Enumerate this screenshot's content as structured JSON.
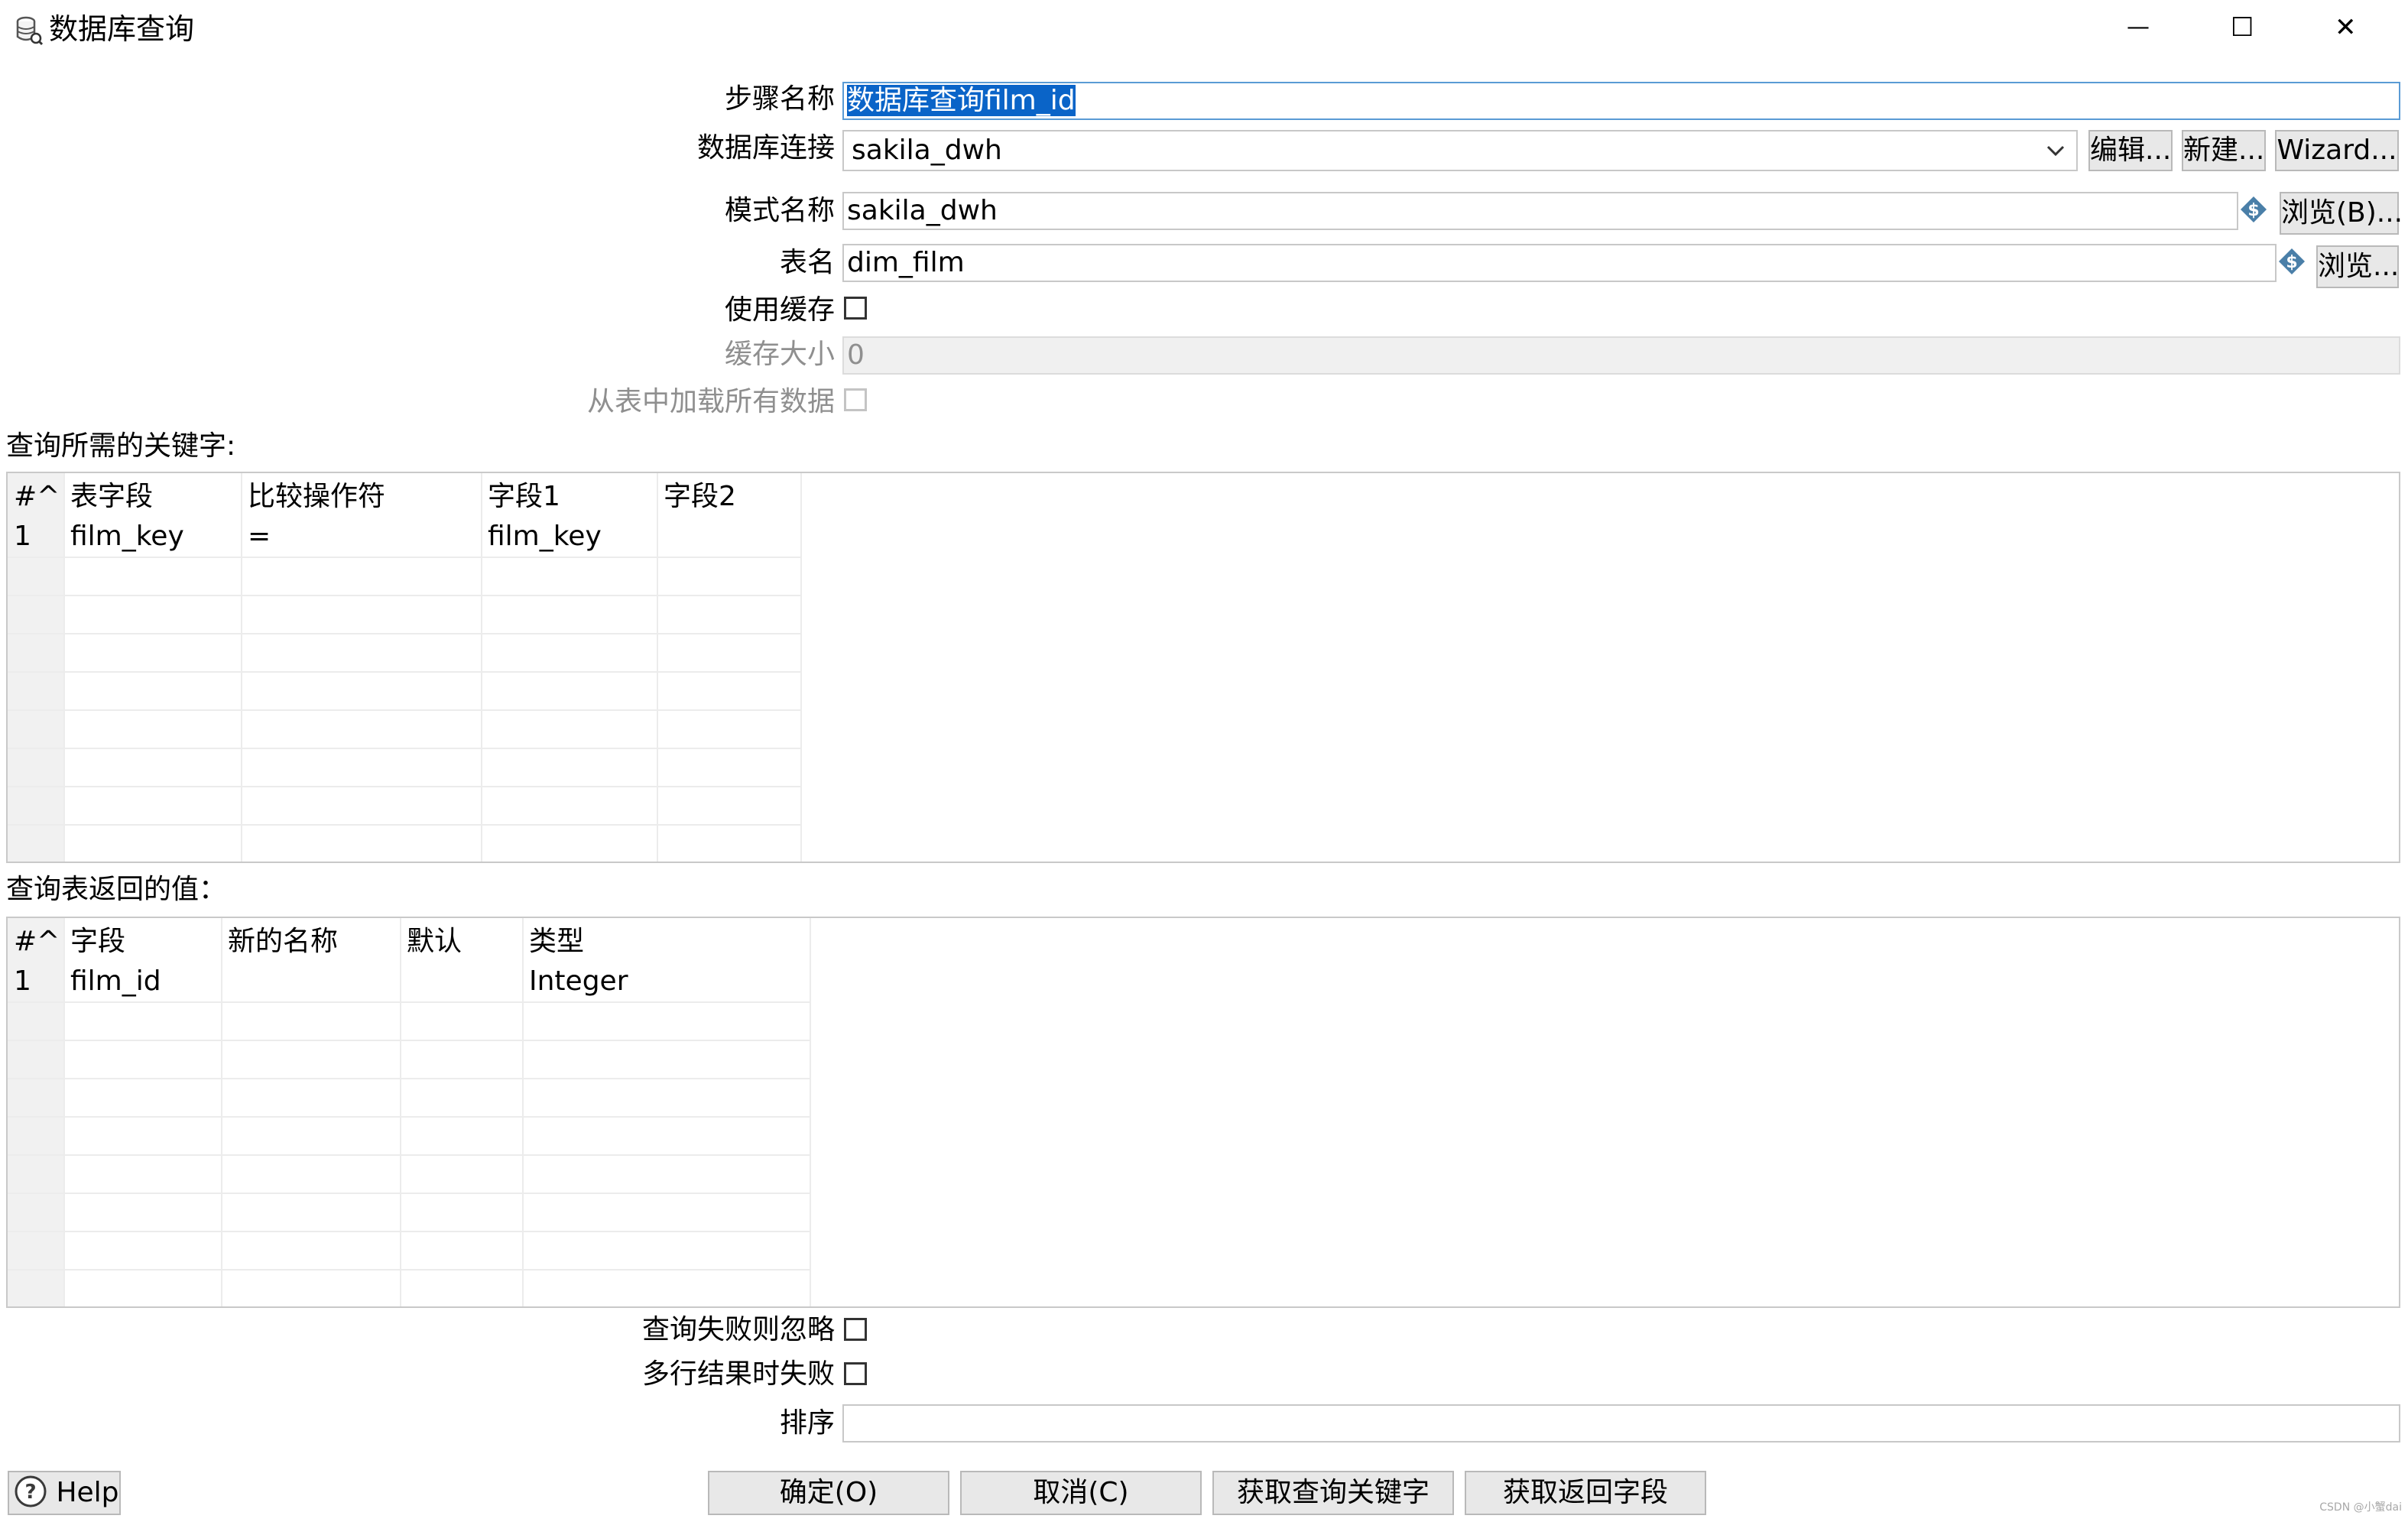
{
  "window": {
    "title": "数据库查询",
    "minimize_glyph": "—",
    "maximize_glyph": "☐",
    "close_glyph": "✕"
  },
  "form": {
    "step_name": {
      "label": "步骤名称",
      "value": "数据库查询film_id"
    },
    "db_connection": {
      "label": "数据库连接",
      "value": "sakila_dwh",
      "edit_button": "编辑...",
      "new_button": "新建...",
      "wizard_button": "Wizard..."
    },
    "schema": {
      "label": "模式名称",
      "value": "sakila_dwh",
      "browse_button": "浏览(B)..."
    },
    "table": {
      "label": "表名",
      "value": "dim_film",
      "browse_button": "浏览..."
    },
    "use_cache": {
      "label": "使用缓存",
      "checked": false
    },
    "cache_size": {
      "label": "缓存大小",
      "value": "0"
    },
    "load_all": {
      "label": "从表中加载所有数据",
      "checked": false
    }
  },
  "keys_section": {
    "title": "查询所需的关键字:",
    "columns": [
      "#^",
      "表字段",
      "比较操作符",
      "字段1",
      "字段2"
    ],
    "rows": [
      {
        "num": "1",
        "table_field": "film_key",
        "operator": "=",
        "field1": "film_key",
        "field2": ""
      }
    ]
  },
  "return_section": {
    "title": "查询表返回的值：",
    "columns": [
      "#^",
      "字段",
      "新的名称",
      "默认",
      "类型"
    ],
    "rows": [
      {
        "num": "1",
        "field": "film_id",
        "new_name": "",
        "default": "",
        "type": "Integer"
      }
    ]
  },
  "options": {
    "fail_ignore": {
      "label": "查询失败则忽略",
      "checked": false
    },
    "multi_fail": {
      "label": "多行结果时失败",
      "checked": false
    },
    "order_by": {
      "label": "排序",
      "value": ""
    }
  },
  "footer": {
    "help": "Help",
    "ok": "确定(O)",
    "cancel": "取消(C)",
    "get_keys": "获取查询关键字",
    "get_return": "获取返回字段",
    "watermark": "CSDN @小蟹dai"
  }
}
